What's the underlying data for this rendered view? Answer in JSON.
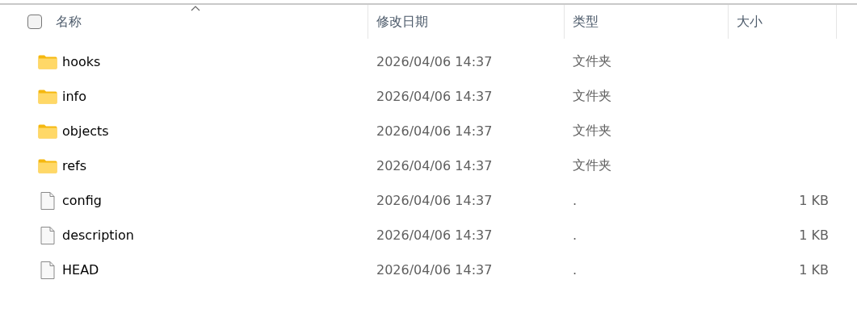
{
  "header": {
    "select_all": {
      "checked": false
    },
    "columns": [
      {
        "label": "名称",
        "sorted": true
      },
      {
        "label": "修改日期",
        "sorted": false
      },
      {
        "label": "类型",
        "sorted": false
      },
      {
        "label": "大小",
        "sorted": false
      }
    ]
  },
  "rows": [
    {
      "kind": "folder",
      "name": "hooks",
      "modified": "2026/04/06 14:37",
      "type": "文件夹"
    },
    {
      "kind": "folder",
      "name": "info",
      "modified": "2026/04/06 14:37",
      "type": "文件夹"
    },
    {
      "kind": "folder",
      "name": "objects",
      "modified": "2026/04/06 14:37",
      "type": "文件夹"
    },
    {
      "kind": "folder",
      "name": "refs",
      "modified": "2026/04/06 14:37",
      "type": "文件夹"
    },
    {
      "kind": "file",
      "name": "config",
      "modified": "2026/04/06 14:37",
      "type": ".",
      "size": "1 KB"
    },
    {
      "kind": "file",
      "name": "description",
      "modified": "2026/04/06 14:37",
      "type": ".",
      "size": "1 KB"
    },
    {
      "kind": "file",
      "name": "HEAD",
      "modified": "2026/04/06 14:37",
      "type": ".",
      "size": "1 KB"
    }
  ]
}
